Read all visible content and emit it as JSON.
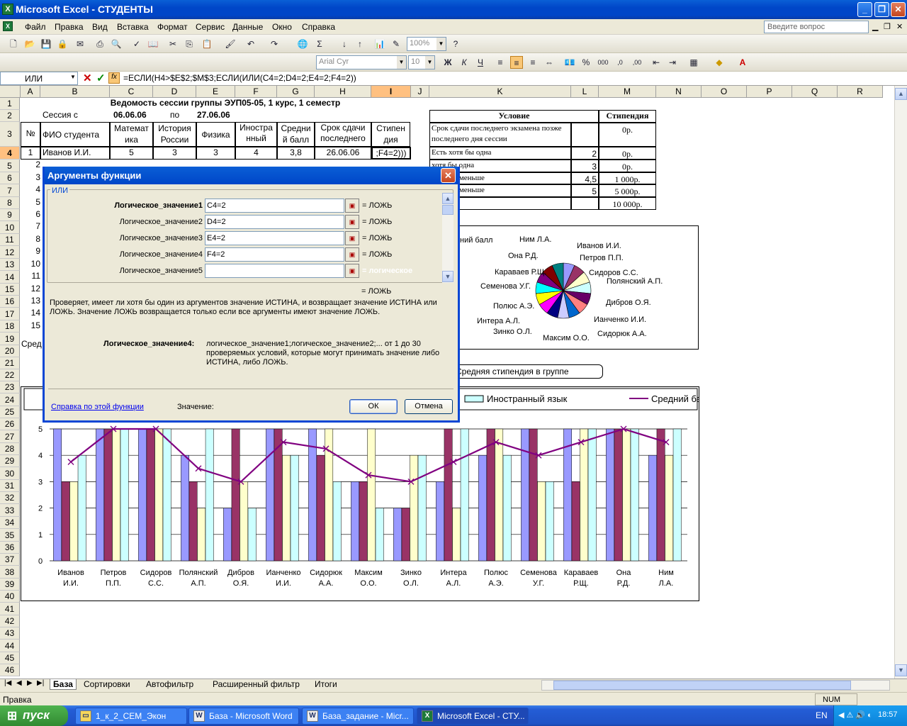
{
  "app": {
    "title": "Microsoft Excel - СТУДЕНТЫ"
  },
  "menu": {
    "items": [
      "Файл",
      "Правка",
      "Вид",
      "Вставка",
      "Формат",
      "Сервис",
      "Данные",
      "Окно",
      "Справка"
    ],
    "ask_placeholder": "Введите вопрос"
  },
  "toolbar": {
    "zoom": "100%",
    "font": "Arial Cyr",
    "size": "10"
  },
  "formula_bar": {
    "name_box": "ИЛИ",
    "formula": "=ЕСЛИ(H4>$E$2;$M$3;ЕСЛИ(ИЛИ(C4=2;D4=2;E4=2;F4=2))"
  },
  "columns": [
    "A",
    "B",
    "C",
    "D",
    "E",
    "F",
    "G",
    "H",
    "I",
    "J",
    "K",
    "L",
    "M",
    "N",
    "O",
    "P",
    "Q",
    "R"
  ],
  "rows": [
    "1",
    "2",
    "3",
    "4",
    "5",
    "6",
    "7",
    "8",
    "9",
    "10",
    "11",
    "12",
    "13",
    "14",
    "15",
    "16",
    "17",
    "18",
    "19",
    "20",
    "21",
    "22",
    "23",
    "24",
    "25",
    "26",
    "27",
    "28",
    "29",
    "30",
    "31",
    "32",
    "33",
    "34",
    "35",
    "36",
    "37",
    "38",
    "39",
    "40",
    "41",
    "42",
    "43",
    "44",
    "45",
    "46"
  ],
  "sheet": {
    "title": "Ведомость сессии группы ЭУП05-05, 1 курс, 1 семестр",
    "session_label": "Сессия с",
    "session_from": "06.06.06",
    "by_label": "по",
    "session_to": "27.06.06",
    "headers": [
      "№",
      "ФИО студента",
      "Математ ика",
      "История России",
      "Физика",
      "Иностра нный язык",
      "Средни й балл",
      "Срок сдачи последнего экзамена",
      "Стипен дия"
    ],
    "row4": [
      "1",
      "Иванов И.И.",
      "5",
      "3",
      "3",
      "4",
      "3,8",
      "26.06.06",
      ";F4=2)))"
    ],
    "visible_numbers": [
      "2",
      "3",
      "4",
      "5",
      "6",
      "7",
      "8",
      "9",
      "10",
      "11",
      "12",
      "13",
      "14",
      "15"
    ],
    "avg_row_label": "Сред"
  },
  "conditions": {
    "head_condition": "Условие",
    "head_stipend": "Стипендия",
    "rows": [
      {
        "cond": "Срок сдачи последнего экзамена позже последнего дня сессии",
        "n": "",
        "val": "0р."
      },
      {
        "cond": "Есть хотя бы одна",
        "n": "2",
        "val": "0р."
      },
      {
        "cond": "хотя бы одна",
        "n": "3",
        "val": "0р."
      },
      {
        "cond": "ий балл меньше",
        "n": "4,5",
        "val": "1 000р."
      },
      {
        "cond": "ий балл меньше",
        "n": "5",
        "val": "5 000р."
      },
      {
        "cond": "",
        "n": "",
        "val": "10 000р."
      }
    ]
  },
  "pie_chart": {
    "partial_title": "ний балл",
    "labels": [
      "Ним Л.А.",
      "Иванов И.И.",
      "Петров П.П.",
      "Она Р.Д.",
      "Сидоров С.С.",
      "Караваев Р.Щ.",
      "Полянский А.П.",
      "Семенова У.Г.",
      "Дибров О.Я.",
      "Полюс А.Э.",
      "Интера А.Л.",
      "Ианченко И.И.",
      "Зинко О.Л.",
      "Максим О.О.",
      "Сидорюк А.А."
    ]
  },
  "callout": {
    "text": "Средняя стипендия в группе"
  },
  "chart_data": {
    "type": "bar",
    "categories": [
      "Иванов И.И.",
      "Петров П.П.",
      "Сидоров С.С.",
      "Полянский А.П.",
      "Дибров О.Я.",
      "Ианченко И.И.",
      "Сидорюк А.А.",
      "Максим О.О.",
      "Зинко О.Л.",
      "Интера А.Л.",
      "Полюс А.Э.",
      "Семенова У.Г.",
      "Караваев Р.Щ.",
      "Она Р.Д.",
      "Ним Л.А."
    ],
    "series": [
      {
        "name": "",
        "color": "#9999ff",
        "values": [
          5,
          5,
          5,
          4,
          2,
          5,
          5,
          3,
          2,
          3,
          4,
          5,
          5,
          5,
          4
        ]
      },
      {
        "name": "",
        "color": "#993366",
        "values": [
          3,
          5,
          5,
          3,
          5,
          5,
          4,
          3,
          2,
          5,
          5,
          5,
          3,
          5,
          5
        ]
      },
      {
        "name": "",
        "color": "#ffffcc",
        "values": [
          3,
          5,
          5,
          2,
          3,
          4,
          5,
          5,
          4,
          2,
          5,
          3,
          5,
          5,
          4
        ]
      },
      {
        "name": "Иностранный язык",
        "color": "#ccffff",
        "values": [
          4,
          5,
          5,
          5,
          2,
          4,
          3,
          2,
          4,
          5,
          4,
          3,
          5,
          5,
          5
        ]
      }
    ],
    "line": {
      "name": "Средний балл",
      "color": "#800080",
      "values": [
        3.75,
        5,
        5,
        3.5,
        3,
        4.5,
        4.25,
        3.25,
        3,
        3.75,
        4.5,
        4,
        4.5,
        5,
        4.5
      ]
    },
    "ylim": [
      0,
      5
    ],
    "yticks": [
      "0",
      "1",
      "2",
      "3",
      "4",
      "5"
    ],
    "legend_visible": [
      "Иностранный язык",
      "Средний ба"
    ]
  },
  "dialog": {
    "title": "Аргументы функции",
    "group": "ИЛИ",
    "args": [
      {
        "label": "Логическое_значение1",
        "value": "C4=2",
        "result": "= ЛОЖЬ"
      },
      {
        "label": "Логическое_значение2",
        "value": "D4=2",
        "result": "= ЛОЖЬ"
      },
      {
        "label": "Логическое_значение3",
        "value": "E4=2",
        "result": "= ЛОЖЬ"
      },
      {
        "label": "Логическое_значение4",
        "value": "F4=2",
        "result": "= ЛОЖЬ"
      },
      {
        "label": "Логическое_значение5",
        "value": "",
        "result": "= логическое"
      }
    ],
    "total_result": "= ЛОЖЬ",
    "description": "Проверяет, имеет ли хотя бы один из аргументов значение ИСТИНА, и возвращает значение ИСТИНА или ЛОЖЬ. Значение ЛОЖЬ возвращается только если все аргументы имеют значение ЛОЖЬ.",
    "arg_help_label": "Логическое_значение4:",
    "arg_help": "логическое_значение1;логическое_значение2;... от 1 до 30 проверяемых условий, которые могут принимать значение либо ИСТИНА, либо ЛОЖЬ.",
    "help_link": "Справка по этой функции",
    "value_label": "Значение:",
    "ok": "ОК",
    "cancel": "Отмена"
  },
  "sheet_tabs": [
    "База",
    "Сортировки",
    "Автофильтр",
    "Расширенный фильтр",
    "Итоги"
  ],
  "status": {
    "left": "Правка",
    "num": "NUM"
  },
  "taskbar": {
    "start": "пуск",
    "buttons": [
      "1_к_2_СЕМ_Экон",
      "База - Microsoft Word",
      "База_задание - Micr...",
      "Microsoft Excel - СТУ..."
    ],
    "lang": "EN",
    "clock": "18:57"
  }
}
